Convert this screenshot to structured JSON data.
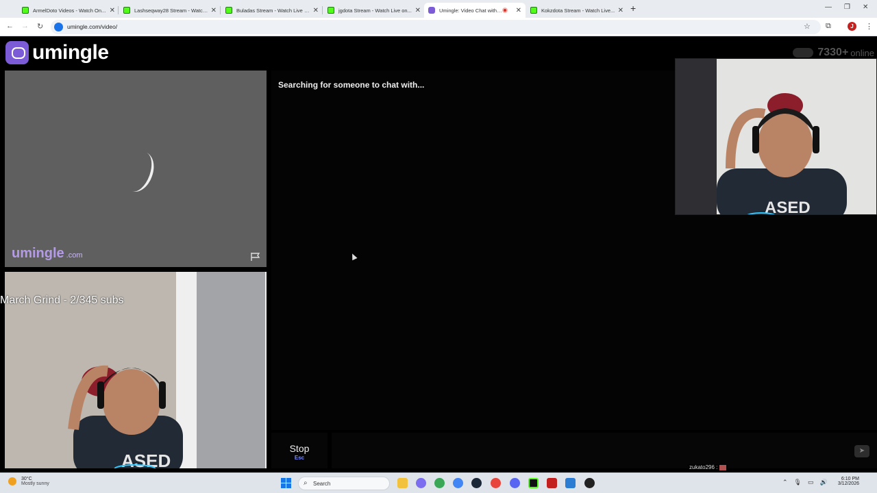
{
  "browser": {
    "tabs": [
      {
        "title": "ArmelDoto Videos - Watch On...",
        "favicon": "kick-icon"
      },
      {
        "title": "Lashseqway28 Stream - Watch...",
        "favicon": "kick-icon"
      },
      {
        "title": "Buladas Stream - Watch Live on...",
        "favicon": "kick-icon"
      },
      {
        "title": "jgdota Stream - Watch Live on...",
        "favicon": "kick-icon"
      },
      {
        "title": "Umingle: Video Chat with S...",
        "favicon": "umingle-icon",
        "active": true
      },
      {
        "title": "Kokzdota Stream - Watch Live...",
        "favicon": "kick-icon"
      }
    ],
    "url": "umingle.com/video/",
    "profile_initial": "J"
  },
  "app": {
    "logo_text": "umingle",
    "online_count": "7330+",
    "online_label": "online",
    "watermark_name": "umingle",
    "watermark_tld": ".com",
    "status_text": "Searching for someone to chat with...",
    "stop_label": "Stop",
    "stop_hint": "Esc",
    "message_placeholder": ""
  },
  "stream_overlay": {
    "sub_goal": "March Grind - 2/345 subs",
    "chat_line": "zukato296 :"
  },
  "taskbar": {
    "weather_temp": "30°C",
    "weather_desc": "Mostly sunny",
    "search_label": "Search",
    "time": "6:10 PM",
    "date": "3/12/2026"
  },
  "colors": {
    "brand": "#7c5cd6",
    "kick_green": "#53fc18"
  }
}
